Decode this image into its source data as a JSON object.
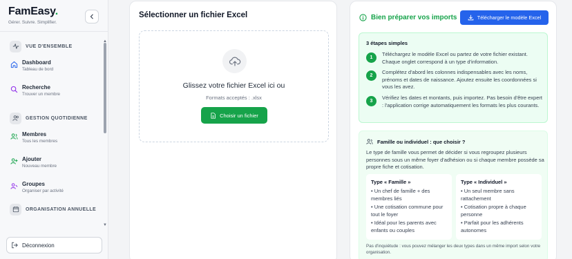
{
  "app": {
    "name": "FamEasy",
    "name_dot": ".",
    "tagline": "Gérer. Suivre. Simplifier."
  },
  "sidebar": {
    "collapse_icon": "chevron-left-icon",
    "sections": [
      {
        "label": "VUE D'ENSEMBLE",
        "icon": "activity-icon"
      },
      {
        "label": "GESTION QUOTIDIENNE",
        "icon": "users-icon"
      },
      {
        "label": "ORGANISATION ANNUELLE",
        "icon": "calendar-icon"
      }
    ],
    "items": [
      {
        "title": "Dashboard",
        "subtitle": "Tableau de bord",
        "icon": "home-icon"
      },
      {
        "title": "Recherche",
        "subtitle": "Trouver un membre",
        "icon": "search-icon"
      },
      {
        "title": "Membres",
        "subtitle": "Tous les membres",
        "icon": "users-icon"
      },
      {
        "title": "Ajouter",
        "subtitle": "Nouveau membre",
        "icon": "user-plus-icon"
      },
      {
        "title": "Groupes",
        "subtitle": "Organiser par activité",
        "icon": "user-group-icon"
      }
    ],
    "logout_label": "Déconnexion"
  },
  "upload": {
    "title": "Sélectionner un fichier Excel",
    "drop_text": "Glissez votre fichier Excel ici ou",
    "formats": "Formats acceptés : .xlsx",
    "choose_button": "Choisir un fichier"
  },
  "guide": {
    "title": "Bien préparer vos imports",
    "download_button": "Télécharger le modèle Excel",
    "steps_title": "3 étapes simples",
    "steps": [
      {
        "num": "1",
        "text": "Téléchargez le modèle Excel ou partez de votre fichier existant. Chaque onglet correspond à un type d'information."
      },
      {
        "num": "2",
        "text": "Complétez d'abord les colonnes indispensables avec les noms, prénoms et dates de naissance. Ajoutez ensuite les coordonnées si vous les avez."
      },
      {
        "num": "3",
        "text": "Vérifiez les dates et montants, puis importez. Pas besoin d'être expert : l'application corrige automatiquement les formats les plus courants."
      }
    ],
    "famille_title": "Famille ou individuel : que choisir ?",
    "famille_desc": "Le type de famille vous permet de décider si vous regroupez plusieurs personnes sous un même foyer d'adhésion ou si chaque membre possède sa propre fiche et cotisation.",
    "types": [
      {
        "title": "Type « Famille »",
        "items": [
          "• Un chef de famille + des membres liés",
          "• Une cotisation commune pour tout le foyer",
          "• Idéal pour les parents avec enfants ou couples"
        ]
      },
      {
        "title": "Type « Individuel »",
        "items": [
          "• Un seul membre sans rattachement",
          "• Cotisation propre à chaque personne",
          "• Parfait pour les adhérents autonomes"
        ]
      }
    ],
    "note": "Pas d'inquiétude : vous pouvez mélanger les deux types dans un même import selon votre organisation."
  },
  "colors": {
    "accent_green": "#16a34a",
    "accent_blue": "#2563eb",
    "success_bg": "#ecfdf3"
  }
}
